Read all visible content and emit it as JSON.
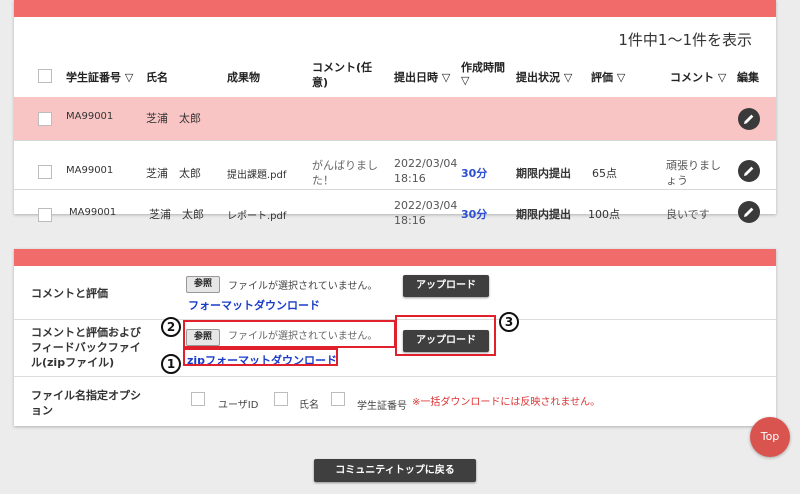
{
  "list": {
    "count_text": "1件中1～1件を表示",
    "headers": {
      "student_id": "学生証番号 ▽",
      "name": "氏名",
      "product": "成果物",
      "comment_line1": "コメント(任",
      "comment_line2": "意)",
      "submitted_at": "提出日時 ▽",
      "duration_line1": "作成時間",
      "duration_line2": "▽",
      "status": "提出状況 ▽",
      "grade": "評価 ▽",
      "comment2": "コメント ▽",
      "edit": "編集"
    },
    "rows": [
      {
        "student_id": "MA99001",
        "name": "芝浦　太郎",
        "file": "",
        "comment_line1": "",
        "comment_line2": "",
        "date": "",
        "time": "",
        "duration": "",
        "status": "",
        "grade": "",
        "feedback_line1": "",
        "feedback_line2": ""
      },
      {
        "student_id": "MA99001",
        "name": "芝浦　太郎",
        "file": "提出課題.pdf",
        "comment_line1": "がんばりまし",
        "comment_line2": "た！",
        "date": "2022/03/04",
        "time": "18:16",
        "duration": "30分",
        "status": "期限内提出",
        "grade": "65点",
        "feedback_line1": "頑張りまし",
        "feedback_line2": "ょう"
      },
      {
        "student_id": "MA99001",
        "name": "芝浦　太郎",
        "file": "レポート.pdf",
        "comment_line1": "",
        "comment_line2": "",
        "date": "2022/03/04",
        "time": "18:16",
        "duration": "30分",
        "status": "期限内提出",
        "grade": "100点",
        "feedback_line1": "良いです",
        "feedback_line2": ""
      }
    ]
  },
  "upload": {
    "section1": {
      "label": "コメントと評価",
      "browse": "参照",
      "no_file": "ファイルが選択されていません。",
      "upload_button": "アップロード",
      "format_link": "フォーマットダウンロード"
    },
    "section2": {
      "label_line1": "コメントと評価および",
      "label_line2": "フィードバックファイ",
      "label_line3": "ル(zipファイル)",
      "browse": "参照",
      "no_file": "ファイルが選択されていません。",
      "upload_button": "アップロード",
      "format_link": "zipフォーマットダウンロード"
    },
    "section3": {
      "label_line1": "ファイル名指定オプシ",
      "label_line2": "ョン",
      "opt_userid": "ユーザID",
      "opt_name": "氏名",
      "opt_student_id": "学生証番号",
      "warning": "※一括ダウンロードには反映されません。"
    }
  },
  "annotations": {
    "one": "1",
    "two": "2",
    "three": "3"
  },
  "top_button": "Top",
  "back_button": "コミュニティトップに戻る",
  "colors": {
    "accent": "#f26b6b",
    "highlight_row": "#f9c4c4",
    "link": "#1a3cc8",
    "annotation": "#e0202a"
  }
}
